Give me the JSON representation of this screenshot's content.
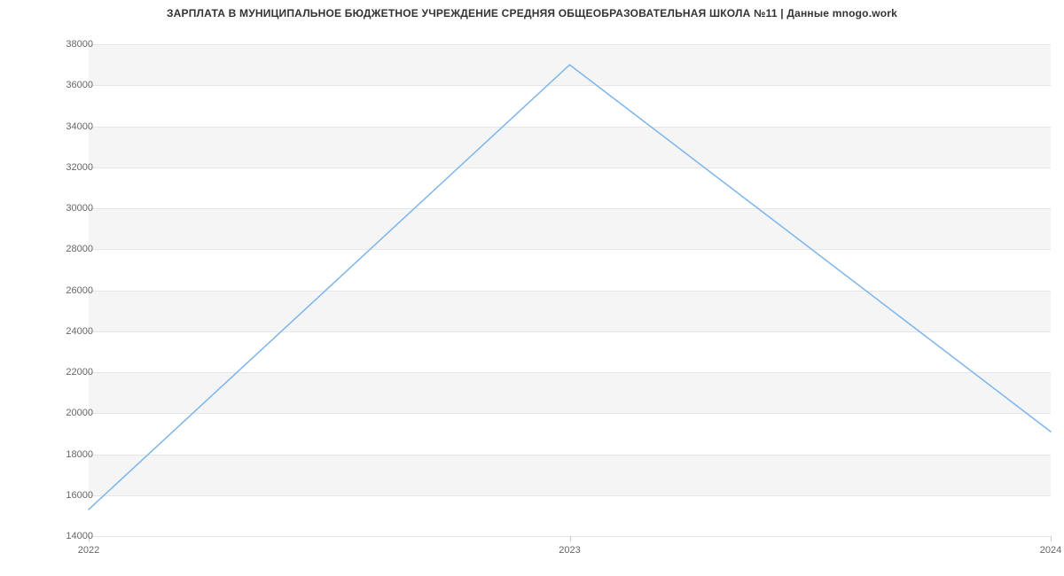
{
  "chart_data": {
    "type": "line",
    "title": "ЗАРПЛАТА В МУНИЦИПАЛЬНОЕ БЮДЖЕТНОЕ УЧРЕЖДЕНИЕ СРЕДНЯЯ ОБЩЕОБРАЗОВАТЕЛЬНАЯ ШКОЛА №11 | Данные mnogo.work",
    "xlabel": "",
    "ylabel": "",
    "x": [
      2022,
      2023,
      2024
    ],
    "values": [
      15300,
      37000,
      19100
    ],
    "x_ticks": [
      2022,
      2023,
      2024
    ],
    "y_ticks": [
      14000,
      16000,
      18000,
      20000,
      22000,
      24000,
      26000,
      28000,
      30000,
      32000,
      34000,
      36000,
      38000
    ],
    "xlim": [
      2022,
      2024
    ],
    "ylim": [
      14000,
      38000
    ],
    "series_color": "#7cb5ec"
  }
}
